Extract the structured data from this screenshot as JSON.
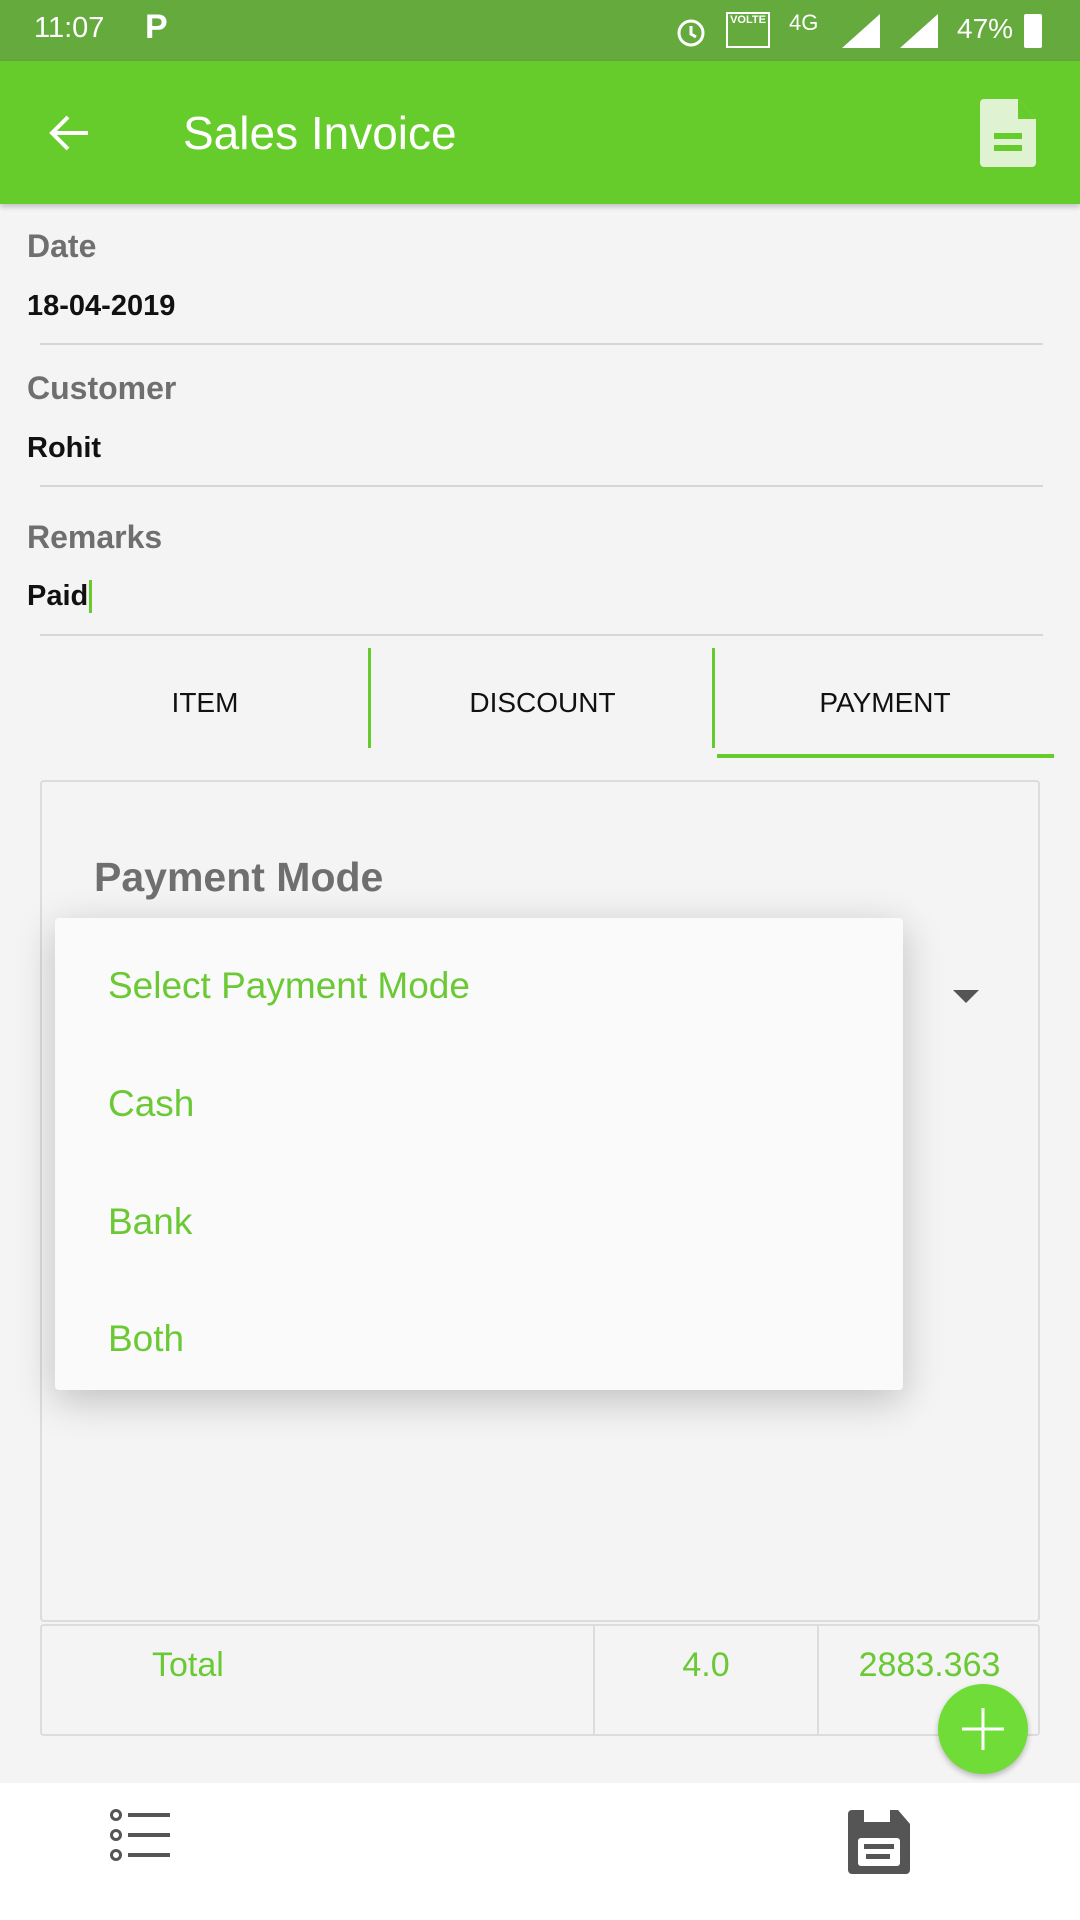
{
  "status_bar": {
    "time": "11:07",
    "network": "4G",
    "volte": "VOLTE",
    "battery": "47%"
  },
  "app_bar": {
    "title": "Sales Invoice",
    "back_icon": "arrow-left-icon",
    "action_icon": "document-icon"
  },
  "form": {
    "date": {
      "label": "Date",
      "value": "18-04-2019"
    },
    "customer": {
      "label": "Customer",
      "value": "Rohit"
    },
    "remarks": {
      "label": "Remarks",
      "value": "Paid"
    }
  },
  "tabs": [
    {
      "label": "ITEM"
    },
    {
      "label": "DISCOUNT"
    },
    {
      "label": "PAYMENT",
      "selected": true
    }
  ],
  "payment": {
    "title": "Payment Mode",
    "dropdown_options": [
      "Select Payment Mode",
      "Cash",
      "Bank",
      "Both"
    ]
  },
  "totals": {
    "label": "Total",
    "quantity": "4.0",
    "amount": "2883.363"
  },
  "colors": {
    "primary": "#66cc2b",
    "status_bar": "#65aa3d",
    "accent_text": "#6bc935"
  }
}
